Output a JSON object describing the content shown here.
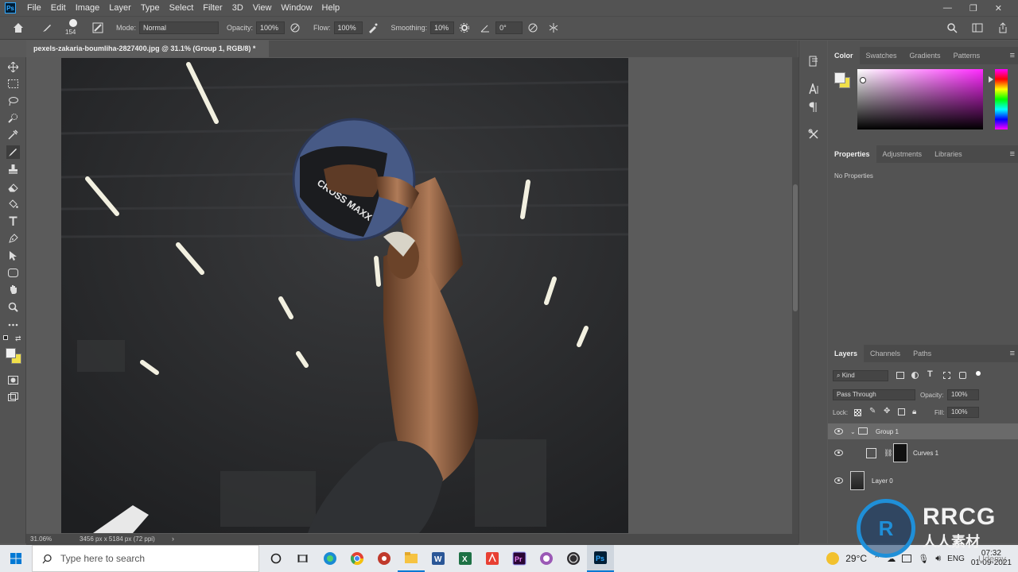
{
  "app": {
    "logo_text": "Ps"
  },
  "menu": [
    "File",
    "Edit",
    "Image",
    "Layer",
    "Type",
    "Select",
    "Filter",
    "3D",
    "View",
    "Window",
    "Help"
  ],
  "window_controls": {
    "minimize": "—",
    "restore": "❐",
    "close": "✕"
  },
  "options": {
    "brush_size": "154",
    "mode_label": "Mode:",
    "mode_value": "Normal",
    "opacity_label": "Opacity:",
    "opacity_value": "100%",
    "flow_label": "Flow:",
    "flow_value": "100%",
    "smoothing_label": "Smoothing:",
    "smoothing_value": "10%",
    "angle_value": "0°"
  },
  "document": {
    "tab_title": "pexels-zakaria-boumliha-2827400.jpg @ 31.1% (Group 1, RGB/8) *",
    "zoom": "31.06%",
    "dimensions": "3456 px x 5184 px (72 ppi)"
  },
  "image": {
    "ball_text": "CROSS MAXX"
  },
  "color_panel": {
    "tabs": [
      "Color",
      "Swatches",
      "Gradients",
      "Patterns"
    ],
    "foreground": "#f1f1f1",
    "background": "#f0df4a"
  },
  "properties_panel": {
    "tabs": [
      "Properties",
      "Adjustments",
      "Libraries"
    ],
    "empty_text": "No Properties"
  },
  "layers_panel": {
    "tabs": [
      "Layers",
      "Channels",
      "Paths"
    ],
    "filter_kind": "Kind",
    "blend_mode": "Pass Through",
    "opacity_label": "Opacity:",
    "opacity_value": "100%",
    "lock_label": "Lock:",
    "fill_label": "Fill:",
    "fill_value": "100%",
    "layers": [
      {
        "name": "Group 1",
        "type": "group",
        "selected": true
      },
      {
        "name": "Curves 1",
        "type": "adjustment",
        "selected": false
      },
      {
        "name": "Layer 0",
        "type": "pixel",
        "selected": false
      }
    ]
  },
  "taskbar": {
    "search_placeholder": "Type here to search",
    "weather": "29°C",
    "language": "ENG",
    "time": "07:32",
    "date": "01-09-2021"
  },
  "watermarks": [
    "RRCG",
    "人人素材",
    "Udemy"
  ]
}
